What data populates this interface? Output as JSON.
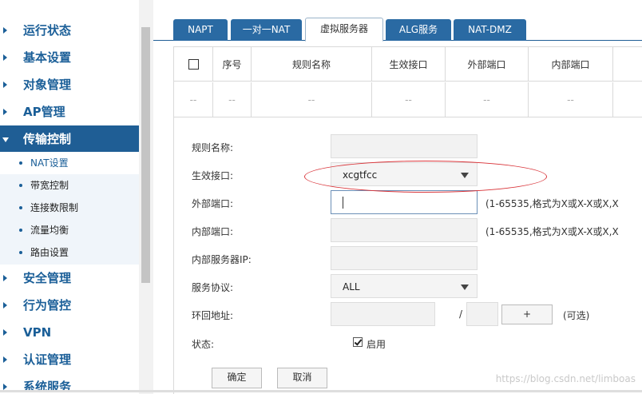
{
  "sidebar": {
    "items": [
      {
        "label": "运行状态"
      },
      {
        "label": "基本设置"
      },
      {
        "label": "对象管理"
      },
      {
        "label": "AP管理"
      },
      {
        "label": "传输控制"
      },
      {
        "label": "安全管理"
      },
      {
        "label": "行为管控"
      },
      {
        "label": "VPN"
      },
      {
        "label": "认证管理"
      },
      {
        "label": "系统服务"
      }
    ],
    "sub_items": [
      {
        "label": "NAT设置"
      },
      {
        "label": "带宽控制"
      },
      {
        "label": "连接数限制"
      },
      {
        "label": "流量均衡"
      },
      {
        "label": "路由设置"
      }
    ]
  },
  "tabs": [
    {
      "label": "NAPT"
    },
    {
      "label": "一对一NAT"
    },
    {
      "label": "虚拟服务器"
    },
    {
      "label": "ALG服务"
    },
    {
      "label": "NAT-DMZ"
    }
  ],
  "table": {
    "headers": [
      "序号",
      "规则名称",
      "生效接口",
      "外部端口",
      "内部端口"
    ],
    "row": [
      "--",
      "--",
      "--",
      "--",
      "--",
      "--"
    ]
  },
  "form": {
    "rule_name_label": "规则名称:",
    "interface_label": "生效接口:",
    "interface_value": "xcgtfcc",
    "ext_port_label": "外部端口:",
    "ext_port_hint": "(1-65535,格式为X或X-X或X,X",
    "int_port_label": "内部端口:",
    "int_port_hint": "(1-65535,格式为X或X-X或X,X",
    "server_ip_label": "内部服务器IP:",
    "protocol_label": "服务协议:",
    "protocol_value": "ALL",
    "loopback_label": "环回地址:",
    "slash": "/",
    "plus": "+",
    "optional": "(可选)",
    "status_label": "状态:",
    "enable_label": "启用",
    "ok": "确定",
    "cancel": "取消"
  },
  "watermark": "https://blog.csdn.net/limboas",
  "colors": {
    "accent": "#1f5e95",
    "tab": "#2a6aa3",
    "highlight": "#d9353a"
  }
}
